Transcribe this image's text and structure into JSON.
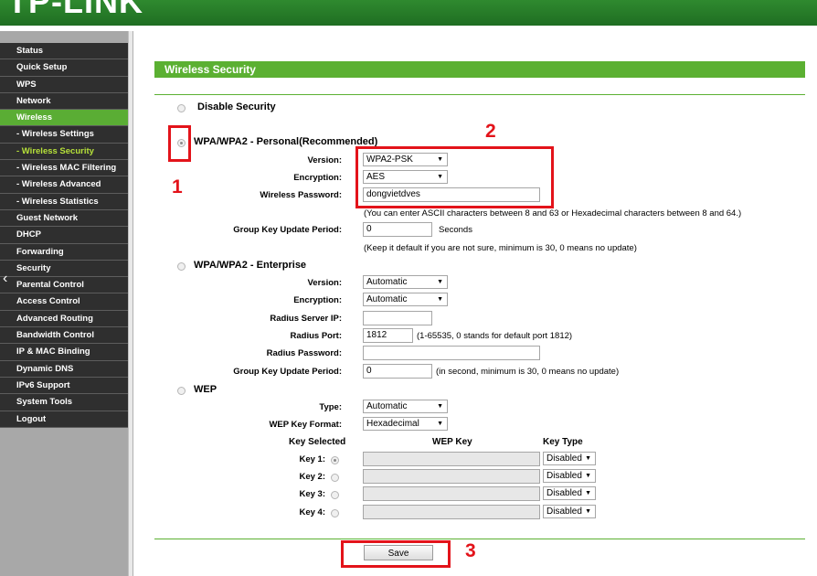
{
  "brand": {
    "logo_text": "TP-LINK"
  },
  "sidebar": {
    "items": [
      {
        "label": "Status"
      },
      {
        "label": "Quick Setup"
      },
      {
        "label": "WPS"
      },
      {
        "label": "Network"
      },
      {
        "label": "Wireless"
      },
      {
        "label": "- Wireless Settings"
      },
      {
        "label": "- Wireless Security"
      },
      {
        "label": "- Wireless MAC Filtering"
      },
      {
        "label": "- Wireless Advanced"
      },
      {
        "label": "- Wireless Statistics"
      },
      {
        "label": "Guest Network"
      },
      {
        "label": "DHCP"
      },
      {
        "label": "Forwarding"
      },
      {
        "label": "Security"
      },
      {
        "label": "Parental Control"
      },
      {
        "label": "Access Control"
      },
      {
        "label": "Advanced Routing"
      },
      {
        "label": "Bandwidth Control"
      },
      {
        "label": "IP & MAC Binding"
      },
      {
        "label": "Dynamic DNS"
      },
      {
        "label": "IPv6 Support"
      },
      {
        "label": "System Tools"
      },
      {
        "label": "Logout"
      }
    ],
    "collapse_glyph": "‹"
  },
  "page": {
    "title": "Wireless Security"
  },
  "disable": {
    "label": "Disable Security"
  },
  "personal": {
    "label": "WPA/WPA2 - Personal(Recommended)",
    "version_label": "Version:",
    "version_value": "WPA2-PSK",
    "encryption_label": "Encryption:",
    "encryption_value": "AES",
    "password_label": "Wireless Password:",
    "password_value": "dongvietdves",
    "password_note": "(You can enter ASCII characters between 8 and 63 or Hexadecimal characters between 8 and 64.)",
    "gk_label": "Group Key Update Period:",
    "gk_value": "0",
    "gk_unit": "Seconds",
    "gk_note": "(Keep it default if you are not sure, minimum is 30, 0 means no update)"
  },
  "enterprise": {
    "label": "WPA/WPA2 - Enterprise",
    "version_label": "Version:",
    "version_value": "Automatic",
    "encryption_label": "Encryption:",
    "encryption_value": "Automatic",
    "radius_ip_label": "Radius Server IP:",
    "radius_ip_value": "",
    "radius_port_label": "Radius Port:",
    "radius_port_value": "1812",
    "radius_port_note": "(1-65535, 0 stands for default port 1812)",
    "radius_pw_label": "Radius Password:",
    "radius_pw_value": "",
    "gk_label": "Group Key Update Period:",
    "gk_value": "0",
    "gk_note": "(in second, minimum is 30, 0 means no update)"
  },
  "wep": {
    "label": "WEP",
    "type_label": "Type:",
    "type_value": "Automatic",
    "format_label": "WEP Key Format:",
    "format_value": "Hexadecimal",
    "col_key_selected": "Key Selected",
    "col_wep_key": "WEP Key",
    "col_key_type": "Key Type",
    "keys": [
      {
        "label": "Key 1:",
        "type": "Disabled"
      },
      {
        "label": "Key 2:",
        "type": "Disabled"
      },
      {
        "label": "Key 3:",
        "type": "Disabled"
      },
      {
        "label": "Key 4:",
        "type": "Disabled"
      }
    ]
  },
  "save_label": "Save",
  "annotations": {
    "n1": "1",
    "n2": "2",
    "n3": "3",
    "color": "#e3131a"
  },
  "colors": {
    "accent": "#5bb032",
    "header": "#1f6e22",
    "nav_bg": "#2f2f2f",
    "nav_active": "#5aad34",
    "nav_selected_text": "#b7e23a"
  }
}
